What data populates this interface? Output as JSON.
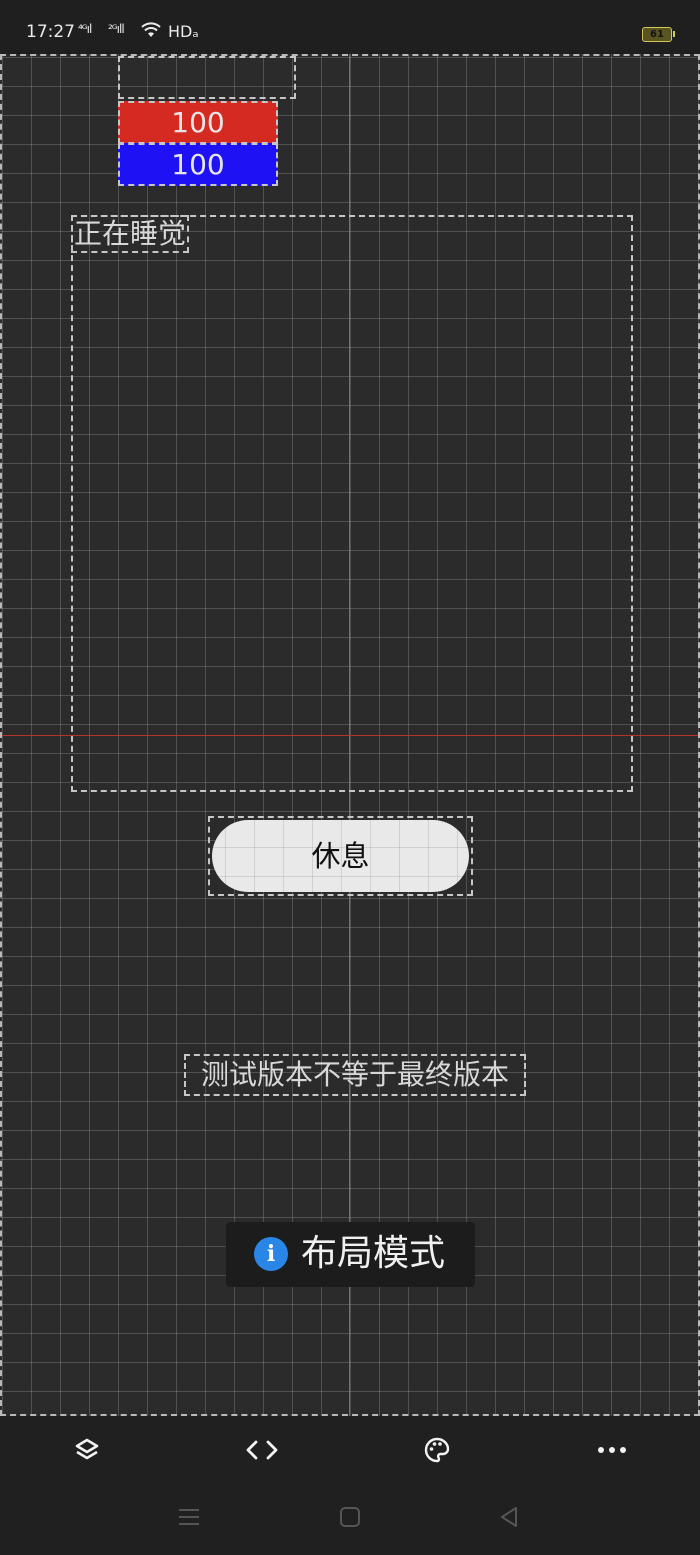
{
  "status_bar": {
    "time": "17:27",
    "signal1": "⁴ᴳıl",
    "signal2": "²ᴳıll",
    "network": "HDₐ",
    "battery": "61"
  },
  "canvas": {
    "bar_red_value": "100",
    "bar_blue_value": "100",
    "sleep_label": "正在睡觉",
    "rest_button_label": "休息",
    "test_note": "测试版本不等于最终版本"
  },
  "toast": {
    "icon": "info-icon",
    "text": "布局模式"
  },
  "toolbar": {
    "items": [
      "layers-icon",
      "code-icon",
      "palette-icon",
      "more-icon"
    ]
  },
  "nav": {
    "items": [
      "menu-icon",
      "home-icon",
      "back-icon"
    ]
  },
  "colors": {
    "red_bar": "#d52a22",
    "blue_bar": "#1e12f5",
    "canvas_bg": "#2b2b2b",
    "info_accent": "#2a86e6"
  }
}
